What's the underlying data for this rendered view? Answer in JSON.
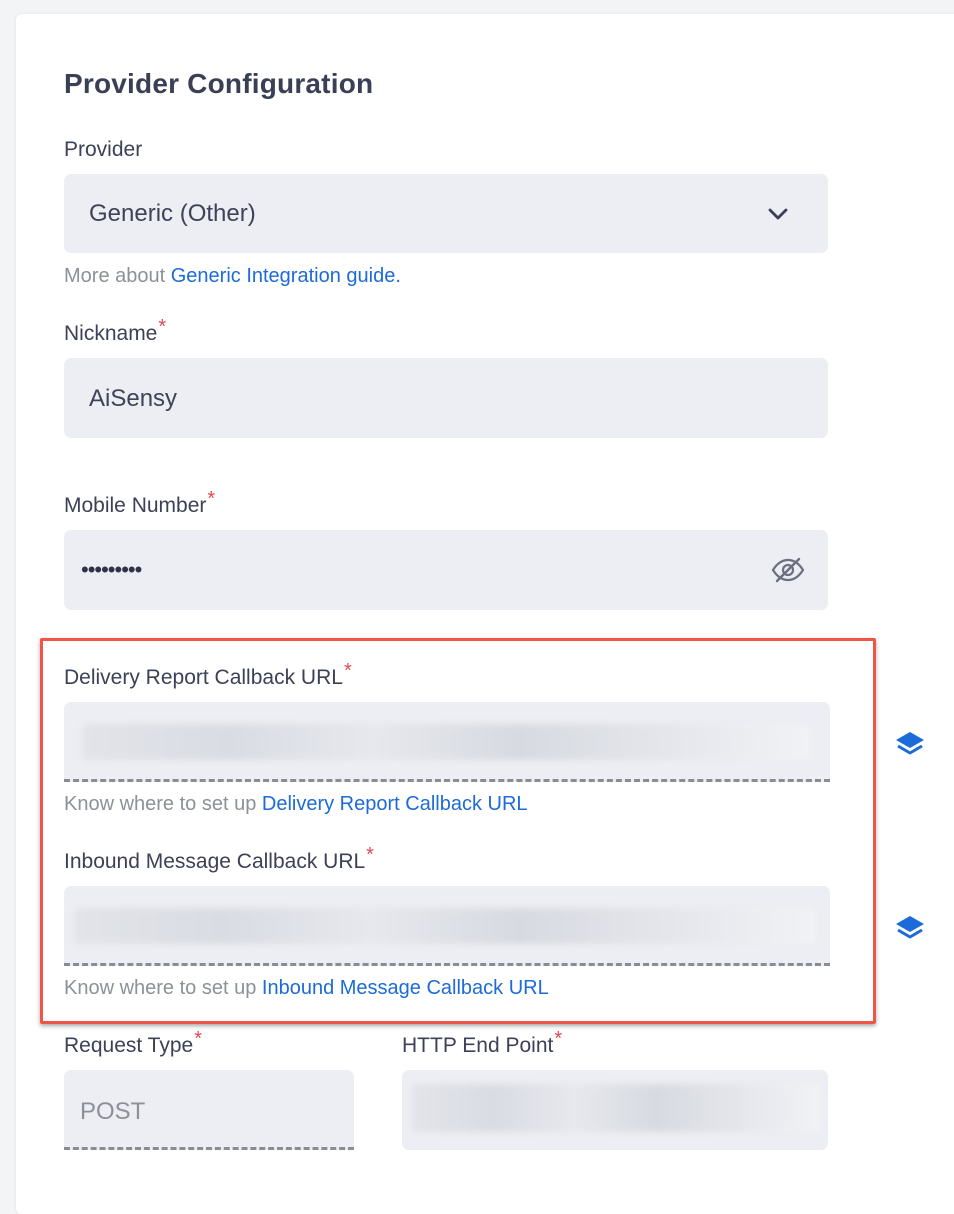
{
  "section_title": "Provider Configuration",
  "provider": {
    "label": "Provider",
    "selected": "Generic (Other)",
    "hint_prefix": "More about ",
    "hint_link": "Generic Integration guide."
  },
  "nickname": {
    "label": "Nickname",
    "required_mark": "*",
    "value": "AiSensy"
  },
  "mobile": {
    "label": "Mobile Number",
    "required_mark": "*",
    "masked_value": "•••••••••"
  },
  "delivery_callback": {
    "label": "Delivery Report Callback URL",
    "required_mark": "*",
    "hint_prefix": "Know where to set up ",
    "hint_link": "Delivery Report Callback URL"
  },
  "inbound_callback": {
    "label": "Inbound Message Callback URL",
    "required_mark": "*",
    "hint_prefix": "Know where to set up ",
    "hint_link": "Inbound Message Callback URL"
  },
  "request_type": {
    "label": "Request Type",
    "required_mark": "*",
    "value": "POST"
  },
  "http_endpoint": {
    "label": "HTTP End Point",
    "required_mark": "*"
  },
  "colors": {
    "accent": "#1c6bd8",
    "required": "#e5484d",
    "highlight_border": "#ee5547",
    "field_bg": "#eceef3"
  },
  "icons": {
    "dropdown": "chevron-down-icon",
    "visibility": "eye-slash-icon",
    "copy": "layers-icon"
  }
}
